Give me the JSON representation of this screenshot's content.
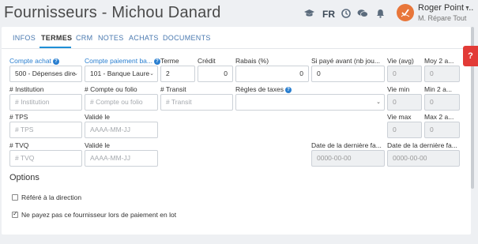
{
  "header": {
    "title": "Fournisseurs - Michou Danard",
    "lang": "FR",
    "user_name": "Roger Point ...",
    "user_company": "M. Répare Tout",
    "icons": [
      "graduation-cap-icon",
      "clock-icon",
      "chat-icon",
      "bell-icon"
    ]
  },
  "tabs": [
    {
      "label": "INFOS"
    },
    {
      "label": "TERMES",
      "active": true
    },
    {
      "label": "CRM"
    },
    {
      "label": "NOTES"
    },
    {
      "label": "ACHATS"
    },
    {
      "label": "DOCUMENTS"
    }
  ],
  "row1": {
    "compte_achat_label": "Compte achat",
    "compte_achat_value": "500 - Dépenses dire",
    "compte_paiement_label": "Compte paiement ba...",
    "compte_paiement_value": "101 - Banque Laure",
    "terme_label": "Terme",
    "terme_value": "2",
    "credit_label": "Crédit",
    "credit_value": "0",
    "rabais_label": "Rabais (%)",
    "rabais_value": "0",
    "si_paye_label": "Si payé avant (nb jou...",
    "si_paye_value": "0",
    "vie_avg_label": "Vie (avg)",
    "vie_avg_value": "0",
    "moy_label": "Moy 2 a...",
    "moy_value": "0"
  },
  "row2": {
    "institution_label": "# Institution",
    "institution_placeholder": "# Institution",
    "compte_folio_label": "# Compte ou folio",
    "compte_folio_placeholder": "# Compte ou folio",
    "transit_label": "# Transit",
    "transit_placeholder": "# Transit",
    "regles_label": "Règles de taxes",
    "vie_min_label": "Vie min",
    "vie_min_value": "0",
    "min_label": "Min 2 a...",
    "min_value": "0"
  },
  "row3": {
    "tps_label": "# TPS",
    "tps_placeholder": "# TPS",
    "valide_label": "Validé le",
    "valide_placeholder": "AAAA-MM-JJ",
    "vie_max_label": "Vie max",
    "vie_max_value": "0",
    "max_label": "Max 2 a...",
    "max_value": "0"
  },
  "row4": {
    "tvq_label": "# TVQ",
    "tvq_placeholder": "# TVQ",
    "valide_label": "Validé le",
    "valide_placeholder": "AAAA-MM-JJ",
    "date_fact1_label": "Date de la dernière fa...",
    "date_fact1_placeholder": "0000-00-00",
    "date_fact2_label": "Date de la dernière fa...",
    "date_fact2_placeholder": "0000-00-00"
  },
  "options": {
    "title": "Options",
    "refere_label": "Référé à la direction",
    "refere_checked": false,
    "ne_payez_label": "Ne payez pas ce fournisseur lors de paiement en lot",
    "ne_payez_checked": true
  },
  "help_tab_label": "?",
  "colors": {
    "accent": "#1f8fd6",
    "help_tab": "#e23b37",
    "avatar": "#e8763a"
  }
}
